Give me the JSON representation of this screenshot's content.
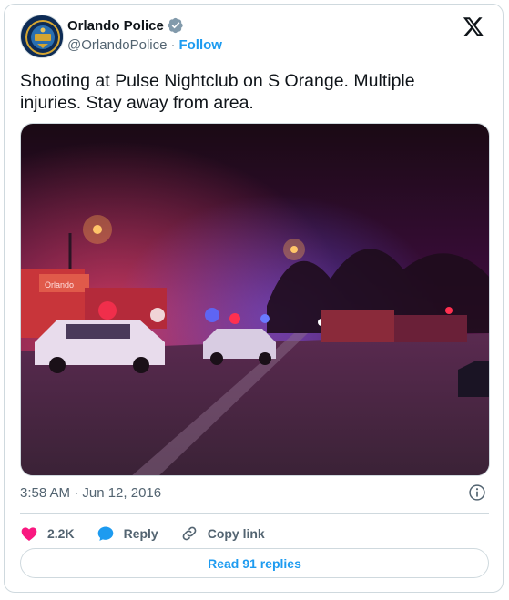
{
  "author": {
    "name": "Orlando Police",
    "handle": "@OrlandoPolice",
    "separator": "·",
    "follow_label": "Follow",
    "avatar_text": "ORLANDO POLICE"
  },
  "tweet": {
    "text": "Shooting at Pulse Nightclub on S Orange. Multiple injuries. Stay away from area.",
    "timestamp": "3:58 AM · Jun 12, 2016"
  },
  "media": {
    "sign_text": "Orlando"
  },
  "actions": {
    "likes": "2.2K",
    "reply_label": "Reply",
    "copy_label": "Copy link"
  },
  "read_replies_label": "Read 91 replies",
  "colors": {
    "brand_blue": "#1d9bf0",
    "like_pink": "#f91880",
    "text_secondary": "#536471",
    "border": "#cfd9de"
  },
  "icons": {
    "logo": "x-logo-icon",
    "verified": "verified-badge-icon",
    "info": "info-icon",
    "like": "heart-icon",
    "reply": "reply-bubble-icon",
    "copy": "link-icon"
  }
}
